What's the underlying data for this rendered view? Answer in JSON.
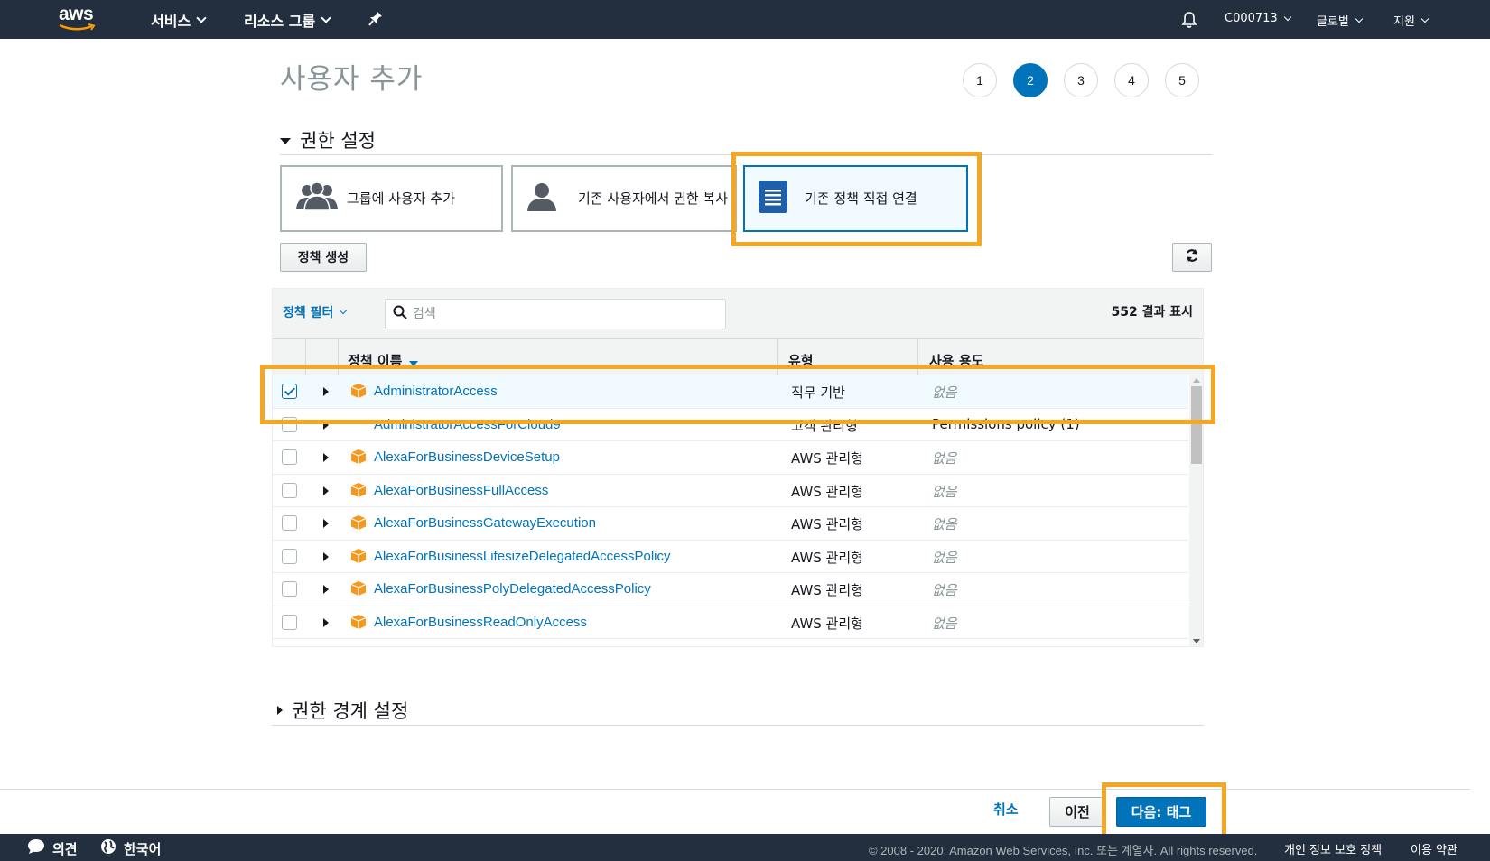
{
  "topnav": {
    "logo": "aws",
    "services": "서비스",
    "resource_groups": "리소스 그룹",
    "account": "C000713",
    "region": "글로벌",
    "support": "지원"
  },
  "page": {
    "title": "사용자 추가",
    "steps": [
      "1",
      "2",
      "3",
      "4",
      "5"
    ],
    "active_step": 2
  },
  "permissions": {
    "section_title": "권한 설정",
    "options": [
      {
        "label": "그룹에 사용자 추가",
        "icon": "users-group-icon"
      },
      {
        "label": "기존 사용자에서 권한 복사",
        "icon": "user-icon"
      },
      {
        "label": "기존 정책 직접 연결",
        "icon": "document-icon",
        "selected": true
      }
    ],
    "create_policy": "정책 생성"
  },
  "table": {
    "filter_label": "정책 필터",
    "search_placeholder": "검색",
    "result_count": "552 결과 표시",
    "columns": {
      "name": "정책 이름",
      "type": "유형",
      "used_as": "사용 용도"
    },
    "rows": [
      {
        "name": "AdministratorAccess",
        "type": "직무 기반",
        "used_as": "없음",
        "checked": true,
        "icon": true
      },
      {
        "name": "AdministratorAccessForCloud9",
        "type": "고객 관리형",
        "used_as": "Permissions policy (1)",
        "checked": false,
        "icon": false
      },
      {
        "name": "AlexaForBusinessDeviceSetup",
        "type": "AWS 관리형",
        "used_as": "없음",
        "checked": false,
        "icon": true
      },
      {
        "name": "AlexaForBusinessFullAccess",
        "type": "AWS 관리형",
        "used_as": "없음",
        "checked": false,
        "icon": true
      },
      {
        "name": "AlexaForBusinessGatewayExecution",
        "type": "AWS 관리형",
        "used_as": "없음",
        "checked": false,
        "icon": true
      },
      {
        "name": "AlexaForBusinessLifesizeDelegatedAccessPolicy",
        "type": "AWS 관리형",
        "used_as": "없음",
        "checked": false,
        "icon": true
      },
      {
        "name": "AlexaForBusinessPolyDelegatedAccessPolicy",
        "type": "AWS 관리형",
        "used_as": "없음",
        "checked": false,
        "icon": true
      },
      {
        "name": "AlexaForBusinessReadOnlyAccess",
        "type": "AWS 관리형",
        "used_as": "없음",
        "checked": false,
        "icon": true
      }
    ]
  },
  "boundary": {
    "section_title": "권한 경계 설정"
  },
  "actions": {
    "cancel": "취소",
    "previous": "이전",
    "next": "다음: 태그"
  },
  "footer": {
    "feedback": "의견",
    "language": "한국어",
    "copyright": "© 2008 - 2020, Amazon Web Services, Inc. 또는 계열사. All rights reserved.",
    "privacy": "개인 정보 보호 정책",
    "terms": "이용 약관"
  },
  "colors": {
    "nav_bg": "#232f3e",
    "link": "#0073bb",
    "highlight": "#f5a623",
    "policy_icon": "#f7981d"
  }
}
